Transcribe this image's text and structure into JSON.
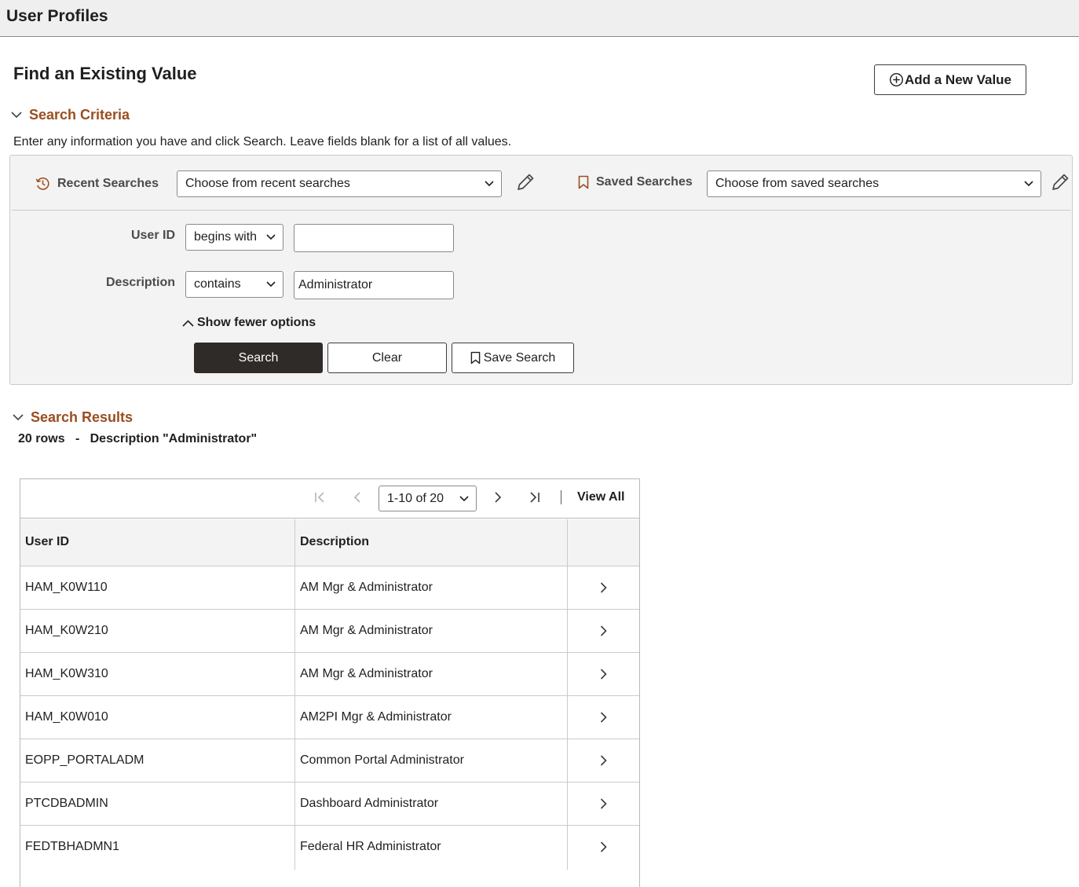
{
  "header": {
    "title": "User Profiles"
  },
  "find": {
    "heading": "Find an Existing Value",
    "add_new_label": "Add a New Value"
  },
  "search_criteria": {
    "title": "Search Criteria",
    "instructions": "Enter any information you have and click Search. Leave fields blank for a list of all values.",
    "recent_label": "Recent Searches",
    "recent_placeholder": "Choose from recent searches",
    "saved_label": "Saved Searches",
    "saved_placeholder": "Choose from saved searches",
    "fields": [
      {
        "label": "User ID",
        "operator": "begins with",
        "value": ""
      },
      {
        "label": "Description",
        "operator": "contains",
        "value": "Administrator"
      }
    ],
    "show_fewer_label": "Show fewer options",
    "search_label": "Search",
    "clear_label": "Clear",
    "save_search_label": "Save Search"
  },
  "results": {
    "title": "Search Results",
    "row_count": "20 rows",
    "separator": "-",
    "criteria_summary": "Description \"Administrator\"",
    "pager_value": "1-10 of 20",
    "view_all_label": "View All",
    "columns": [
      "User ID",
      "Description",
      ""
    ],
    "rows": [
      {
        "user_id": "HAM_K0W110",
        "description": "AM Mgr & Administrator"
      },
      {
        "user_id": "HAM_K0W210",
        "description": "AM Mgr & Administrator"
      },
      {
        "user_id": "HAM_K0W310",
        "description": "AM Mgr & Administrator"
      },
      {
        "user_id": "HAM_K0W010",
        "description": "AM2PI Mgr & Administrator"
      },
      {
        "user_id": "EOPP_PORTALADM",
        "description": "Common Portal Administrator"
      },
      {
        "user_id": "PTCDBADMIN",
        "description": "Dashboard Administrator"
      },
      {
        "user_id": "FEDTBHADMN1",
        "description": "Federal HR Administrator"
      }
    ]
  },
  "colors": {
    "accent": "#9a4e1f",
    "primary_button": "#2f2b29",
    "header_bg": "#f0efef"
  }
}
